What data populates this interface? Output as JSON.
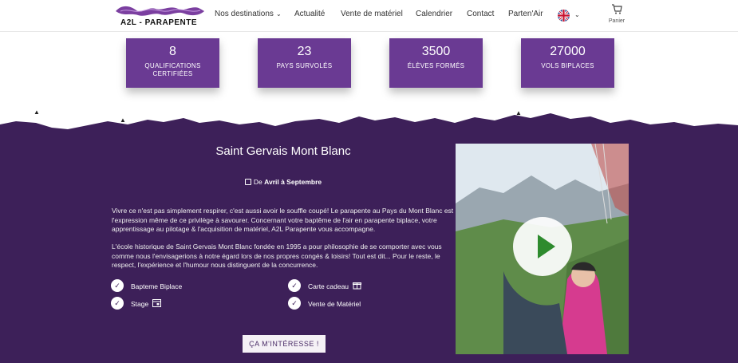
{
  "header": {
    "logo_text": "A2L - PARAPENTE",
    "nav": [
      {
        "label": "Nos destinations",
        "has_dropdown": true
      },
      {
        "label": "Actualité"
      },
      {
        "label": "Vente de matériel"
      },
      {
        "label": "Calendrier"
      },
      {
        "label": "Contact"
      },
      {
        "label": "Parten'Air"
      }
    ],
    "language_icon": "uk-flag-icon",
    "cart_label": "Panier"
  },
  "stats": [
    {
      "number": "8",
      "label": "QUALIFICATIONS CERTIFIÉES"
    },
    {
      "number": "23",
      "label": "PAYS SURVOLÉS"
    },
    {
      "number": "3500",
      "label": "ÉLÈVES FORMÉS"
    },
    {
      "number": "27000",
      "label": "VOLS BIPLACES"
    }
  ],
  "destination": {
    "title": "Saint Gervais Mont Blanc",
    "date_prefix": "De",
    "date_range": "Avril à Septembre",
    "paragraph_1": "Vivre ce n'est pas simplement respirer, c'est aussi avoir le souffle coupé! Le parapente au Pays du Mont Blanc est l'expression même de ce privilège à savourer. Concernant votre baptême de l'air en parapente biplace, votre apprentissage au pilotage & l'acquisition de matériel, A2L Parapente vous accompagne.",
    "paragraph_2": "L'école historique de Saint Gervais Mont Blanc fondée en 1995 a pour philosophie de se comporter avec vous comme nous l'envisagerions à notre égard lors de nos propres congés & loisirs! Tout est dit... Pour le reste, le respect, l'expérience et l'humour nous distinguent de la concurrence.",
    "features": [
      {
        "label": "Bapteme Biplace",
        "icon": ""
      },
      {
        "label": "Carte cadeau",
        "icon": "gift-icon"
      },
      {
        "label": "Stage",
        "icon": "calendar-icon"
      },
      {
        "label": "Vente de Matériel",
        "icon": ""
      }
    ],
    "cta_label": "ÇA M'INTÉRESSE !"
  },
  "colors": {
    "purple_dark": "#3d2059",
    "purple_stat": "#6a3a93",
    "play_green": "#2e8b2e"
  }
}
